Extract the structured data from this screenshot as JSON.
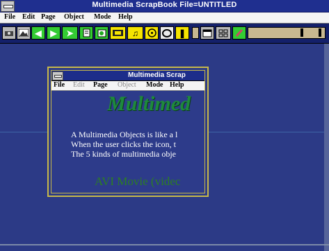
{
  "window": {
    "title": "Multimedia ScrapBook  File=UNTITLED"
  },
  "menubar": {
    "items": [
      "File",
      "Edit",
      "Page",
      "Object",
      "Mode",
      "Help"
    ]
  },
  "toolbar": {
    "buttons": [
      {
        "name": "picture-tool",
        "icon": "camera-icon",
        "color": "gray"
      },
      {
        "name": "landscape-tool",
        "icon": "landscape-icon",
        "color": "gray"
      },
      {
        "name": "first-page",
        "icon": "arrow-left-icon",
        "color": "green"
      },
      {
        "name": "next-page",
        "icon": "arrow-right-icon",
        "color": "green"
      },
      {
        "name": "jump-page",
        "icon": "arrow-jump-icon",
        "color": "green"
      },
      {
        "name": "document-tool",
        "icon": "document-icon",
        "color": "green"
      },
      {
        "name": "image-tool",
        "icon": "image-icon",
        "color": "green"
      },
      {
        "name": "movie-tool",
        "icon": "film-icon",
        "color": "yellow"
      },
      {
        "name": "sound-tool",
        "icon": "speaker-icon",
        "color": "yellow"
      },
      {
        "name": "cd-tool",
        "icon": "disc-icon",
        "color": "yellow"
      },
      {
        "name": "record-tool",
        "icon": "record-icon",
        "color": "white"
      },
      {
        "name": "play-tool",
        "icon": "play-pause-icon",
        "color": "yellow"
      },
      {
        "name": "layout-tool",
        "icon": "layout-icon",
        "color": "gray"
      },
      {
        "name": "grid-tool",
        "icon": "grid-icon",
        "color": "gray"
      },
      {
        "name": "paint-tool",
        "icon": "brush-icon",
        "color": "green"
      }
    ]
  },
  "child": {
    "title": "Multimedia Scrap",
    "menu": [
      "File",
      "Edit",
      "Page",
      "Object",
      "Mode",
      "Help"
    ],
    "heading": "Multimed",
    "lines": [
      "A Multimedia Objects is like a l",
      "When the user clicks the icon, t",
      "The 5 kinds of multimedia obje"
    ],
    "avi": "AVI Movie  (videc"
  },
  "colors": {
    "desktop": "#2c3a86",
    "heading": "#1e8a3c",
    "frame": "#c8b94a"
  }
}
